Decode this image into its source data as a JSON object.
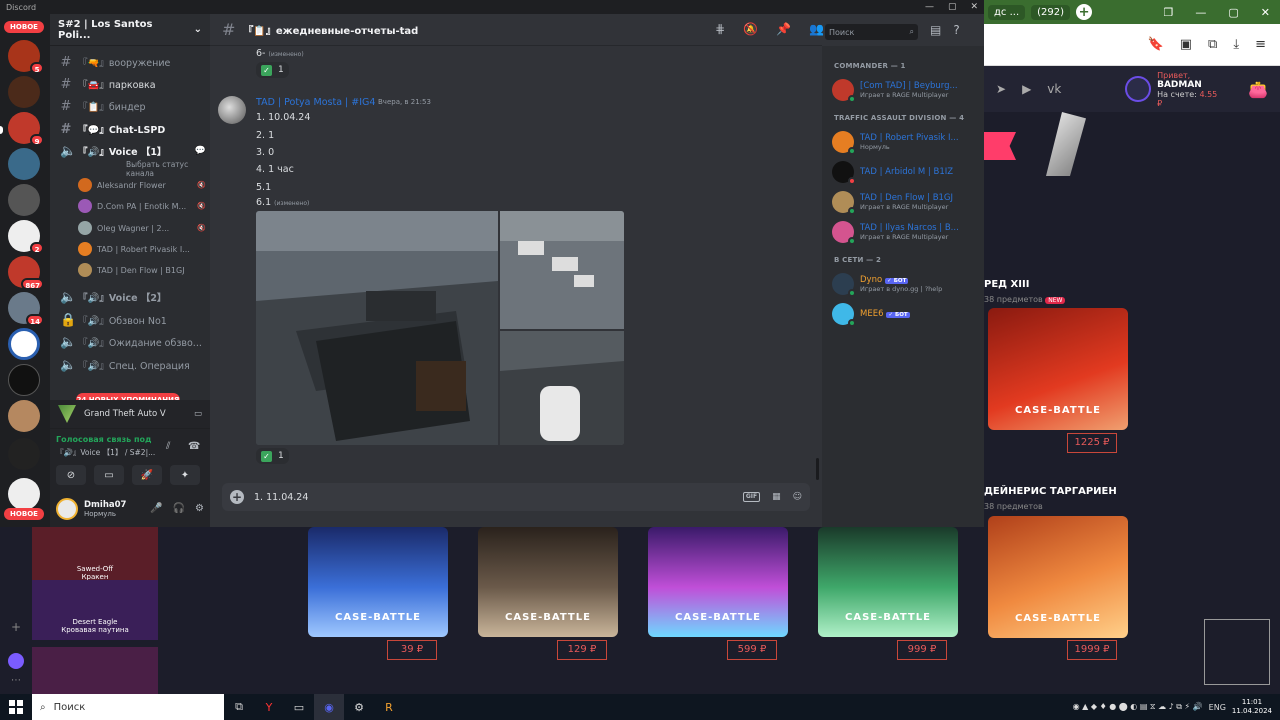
{
  "discord": {
    "app_name": "Discord",
    "server_name": "S#2 | Los Santos Poli...",
    "channels": [
      {
        "type": "text",
        "label": "『🔫』вооружение",
        "bold": false
      },
      {
        "type": "text",
        "label": "『🚘』парковка",
        "bold": false
      },
      {
        "type": "text",
        "label": "『📋』биндер",
        "bold": false
      },
      {
        "type": "text",
        "label": "『💬』Chat-LSPD",
        "bold": true
      },
      {
        "type": "voice",
        "label": "『🔊』Voice 【1】",
        "bold": true
      }
    ],
    "channel_status_hint": "Выбрать статус канала",
    "voice_users": [
      {
        "name": "Aleksandr Flower",
        "color": "#d2691e"
      },
      {
        "name": "D.Com PA | Enotik M...",
        "color": "#9b59b6"
      },
      {
        "name": "Oleg Wagner | 2...",
        "color": "#95a5a6"
      },
      {
        "name": "TAD | Robert Pivasik I...",
        "color": "#e67e22"
      },
      {
        "name": "TAD | Den Flow | B1GJ",
        "color": "#b08d57"
      }
    ],
    "more_channels": [
      {
        "type": "voice",
        "label": "『🔊』Voice 【2】",
        "bold": true
      },
      {
        "type": "lock",
        "label": "『🔊』Обзвон No1",
        "bold": false
      },
      {
        "type": "voice",
        "label": "『🔊』Ожидание обзво...",
        "bold": false
      },
      {
        "type": "voice",
        "label": "『🔊』Спец. Операция",
        "bold": false
      }
    ],
    "mentions_pill": "24 НОВЫХ УПОМИНАНИЯ",
    "activity": "Grand Theft Auto V",
    "voice_status": "Голосовая связь под",
    "voice_channel": "『🔊』Voice 【1】 / S#2|...",
    "user": {
      "name": "Dmiha07",
      "status": "Нормуль"
    },
    "server_badges": [
      "5",
      "9",
      "2",
      "867",
      "14"
    ],
    "new_label": "НОВОЕ",
    "chat": {
      "channel_name": "『📋』ежедневные-отчеты-tad",
      "prev_line": "6- ",
      "edited_label": "(изменено)",
      "reaction_count": "1",
      "author": "TAD | Potya Mosta | #IG4",
      "timestamp": "Вчера, в 21:53",
      "lines": [
        "1. 10.04.24",
        "2. 1",
        "3. 0",
        "4. 1 час",
        "5.1",
        "6.1"
      ],
      "composer_value": "1. 11.04.24",
      "gif_label": "GIF",
      "search_placeholder": "Поиск"
    },
    "member_groups": [
      {
        "title": "COMMANDER — 1",
        "members": [
          {
            "name": "[Com TAD] | Beyburg...",
            "activity": "Играет в RAGE Multiplayer",
            "color": "#c0392b",
            "status": "#23a55a"
          }
        ]
      },
      {
        "title": "TRAFFIC ASSAULT DIVISION — 4",
        "members": [
          {
            "name": "TAD | Robert Pivasik I...",
            "activity": "Нормуль",
            "color": "#e67e22",
            "status": "#23a55a"
          },
          {
            "name": "TAD | Arbidol M | B1IZ",
            "activity": "",
            "color": "#111111",
            "status": "#f23f43"
          },
          {
            "name": "TAD | Den Flow | B1GJ",
            "activity": "Играет в RAGE Multiplayer",
            "color": "#b08d57",
            "status": "#23a55a"
          },
          {
            "name": "TAD | Ilyas Narcos | B...",
            "activity": "Играет в RAGE Multiplayer",
            "color": "#d4548f",
            "status": "#23a55a"
          }
        ]
      },
      {
        "title": "В СЕТИ — 2",
        "members": [
          {
            "name": "Dyno",
            "activity": "Играет в dyno.gg | ?help",
            "color": "#2c3e50",
            "status": "#23a55a",
            "bot": true
          },
          {
            "name": "MEE6",
            "activity": "",
            "color": "#3fb8e8",
            "status": "#23a55a",
            "bot": true
          }
        ]
      }
    ],
    "bot_label": "✓ БОТ"
  },
  "browser": {
    "tab_text": "дс ...",
    "tab_count": "(292)",
    "plus": "+"
  },
  "site": {
    "greeting": "Привет,",
    "username": "BADMAN",
    "balance_label": "На счете:",
    "balance": "4.55 ₽",
    "cases_right": [
      {
        "title": "РЕД XIII",
        "sub": "38 предметов",
        "new": "NEW",
        "price": "1225 ₽"
      },
      {
        "title": "ДЕЙНЕРИС ТАРГАРИЕН",
        "sub": "38 предметов",
        "new": "",
        "price": "1999 ₽"
      }
    ],
    "case_label": "CASE-BATTLE",
    "cases_bottom": [
      {
        "price": "39 ₽",
        "color": "#3b6fd8"
      },
      {
        "price": "129 ₽",
        "color": "#6b5a4a"
      },
      {
        "price": "599 ₽",
        "color": "#c04fd8"
      },
      {
        "price": "999 ₽",
        "color": "#3fa86a"
      }
    ],
    "side_items": [
      {
        "line1": "Sawed-Off",
        "line2": "Кракен",
        "color": "#5a1e28"
      },
      {
        "line1": "Desert Eagle",
        "line2": "Кровавая паутина",
        "color": "#3a1f58"
      },
      {
        "line1": "",
        "line2": "",
        "color": "#4a1f46"
      }
    ]
  },
  "taskbar": {
    "search_label": "Поиск",
    "lang": "ENG",
    "time": "11:01",
    "date": "11.04.2024"
  }
}
